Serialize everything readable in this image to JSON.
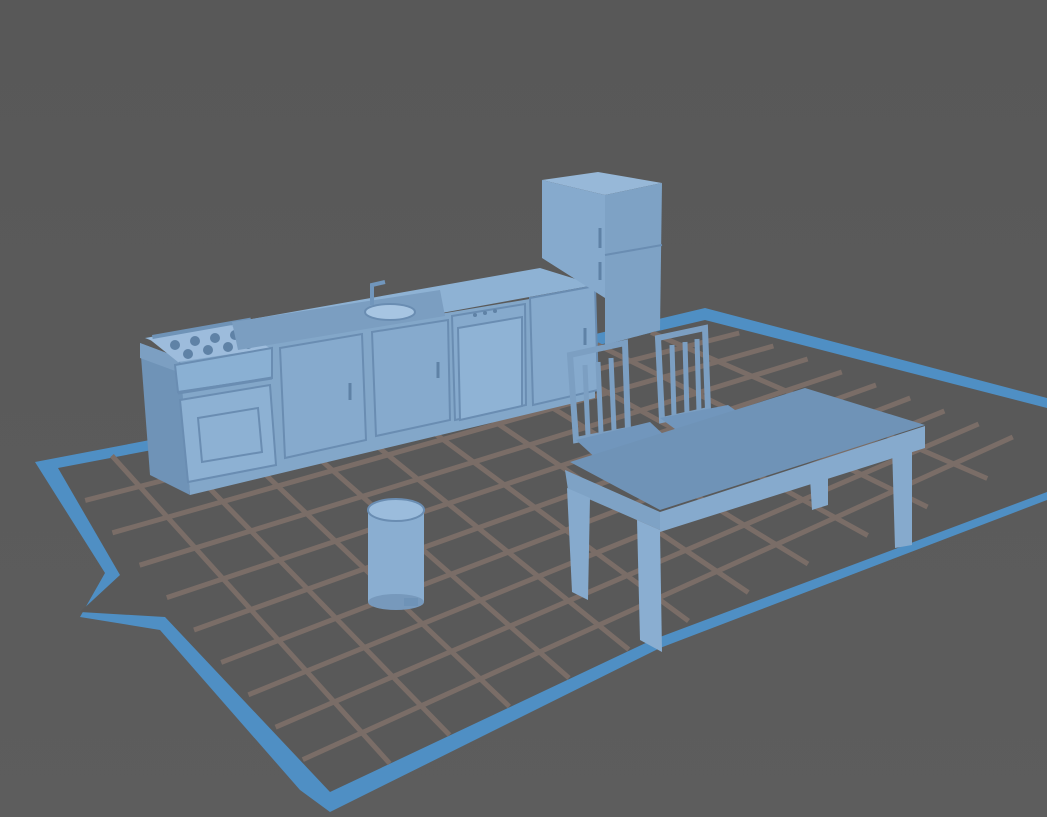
{
  "viewport": {
    "background_color": "#5b5b5b",
    "plate_color": "#4f8fc4",
    "grid_color": "#7a6e68",
    "tile_color": "#595959",
    "model_color": "#8aaed1",
    "model_shade_color": "#6f93b7",
    "model_dark_color": "#5f82a6"
  },
  "scene": {
    "objects": [
      "build-plate",
      "stove-with-oven",
      "sink-counter",
      "dishwasher",
      "base-cabinets",
      "refrigerator",
      "dining-chair-left",
      "dining-chair-right",
      "dining-table",
      "pedal-trash-bin"
    ]
  }
}
